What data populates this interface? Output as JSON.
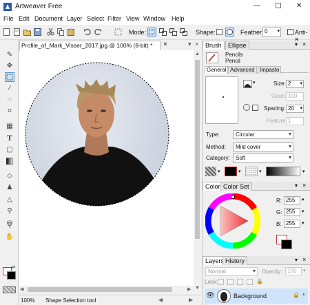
{
  "app": {
    "title": "Artweaver Free"
  },
  "window_controls": {
    "minimize": "—",
    "maximize": "☐",
    "close": "✕"
  },
  "menu": [
    "File",
    "Edit",
    "Document",
    "Layer",
    "Select",
    "Filter",
    "View",
    "Window",
    "Help"
  ],
  "toolbar": {
    "mode_label": "Mode:",
    "shape_label": "Shape:",
    "feather_label": "Feather:",
    "feather_value": "0",
    "antialias_label": "Anti-a"
  },
  "document": {
    "tab_title": "Profile_of_Mark_Visser_2017.jpg @ 100% (8-bit) *",
    "close": "×"
  },
  "status": {
    "zoom": "100%",
    "tool": "Shape Selection tool"
  },
  "brush_panel": {
    "tabs": [
      "Brush",
      "Ellipse"
    ],
    "category": "Pencils",
    "variant": "Pencil",
    "subtabs": [
      "General",
      "Advanced",
      "Impasto"
    ],
    "size_label": "Size:",
    "size_value": "2",
    "grain_label": "Grain:",
    "grain_value": "100",
    "spacing_label": "Spacing:",
    "spacing_value": "20",
    "feature_label": "Feature:",
    "feature_value": "1",
    "type_label": "Type:",
    "type_value": "Circular",
    "method_label": "Method:",
    "method_value": "Mild cover",
    "category_label": "Category:",
    "category_value": "Soft"
  },
  "color_panel": {
    "tabs": [
      "Color",
      "Color Set"
    ],
    "r_label": "R:",
    "r_value": "255",
    "g_label": "G:",
    "g_value": "255",
    "b_label": "B:",
    "b_value": "255"
  },
  "layers_panel": {
    "tabs": [
      "Layers",
      "History"
    ],
    "blend_mode": "Normal",
    "opacity_label": "Opacity:",
    "opacity_value": "100",
    "lock_label": "Lock:",
    "layer_name": "Background"
  },
  "colors": {
    "accent": "#3d85e6",
    "selected_layer": "#cfe3fb"
  }
}
